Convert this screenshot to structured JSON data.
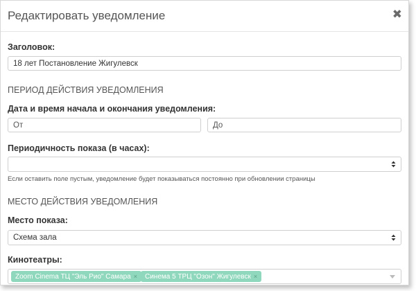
{
  "modal": {
    "title": "Редактировать уведомление",
    "close_glyph": "✖"
  },
  "title_field": {
    "label": "Заголовок:",
    "value": "18 лет Постановление Жигулевск"
  },
  "period": {
    "section_title": "ПЕРИОД ДЕЙСТВИЯ УВЕДОМЛЕНИЯ",
    "datetime_label": "Дата и время начала и окончания уведомления:",
    "from_placeholder": "От",
    "to_placeholder": "До",
    "frequency_label": "Периодичность показа (в часах):",
    "frequency_value": "",
    "frequency_hint": "Если оставить поле пустым, уведомление будет показываться постоянно при обновлении страницы"
  },
  "place": {
    "section_title": "МЕСТО ДЕЙСТВИЯ УВЕДОМЛЕНИЯ",
    "location_label": "Место показа:",
    "location_value": "Схема зала",
    "cinemas_label": "Кинотеатры:",
    "cinemas": [
      {
        "name": "Zoom Cinema ТЦ \"Эль Рио\" Самара",
        "remove": "×"
      },
      {
        "name": "Синема 5 ТРЦ \"Озон\" Жигулевск",
        "remove": "×"
      }
    ]
  },
  "colors": {
    "tag_bg": "#8fd8bd",
    "border": "#cfcfcf"
  }
}
